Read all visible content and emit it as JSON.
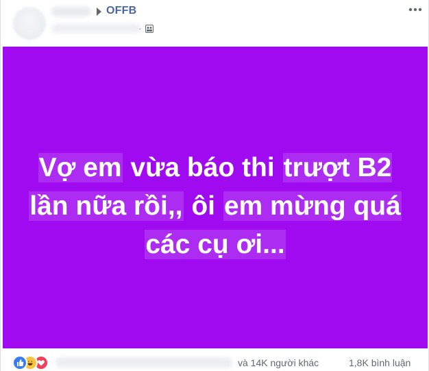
{
  "post": {
    "group_name": "OFFB",
    "meta_separator": "·"
  },
  "card": {
    "lines": [
      [
        "Vợ em",
        " vừa báo thi ",
        "trượt B2"
      ],
      [
        "lần nữa rồi,,",
        " ôi ",
        "em mừng quá"
      ],
      [
        "các cụ ơi..."
      ]
    ]
  },
  "footer": {
    "reactions": [
      "like",
      "haha",
      "love"
    ],
    "reactors_tail": "và 14K người khác",
    "comments": "1,8K bình luận"
  },
  "colors": {
    "card_background": "#a00af0",
    "group_name": "#4b67a1",
    "secondary_text": "#616770"
  },
  "icons": {
    "audience": "group-audience-icon",
    "more": "more-options-icon",
    "group_arrow": "triangle-right-icon"
  }
}
